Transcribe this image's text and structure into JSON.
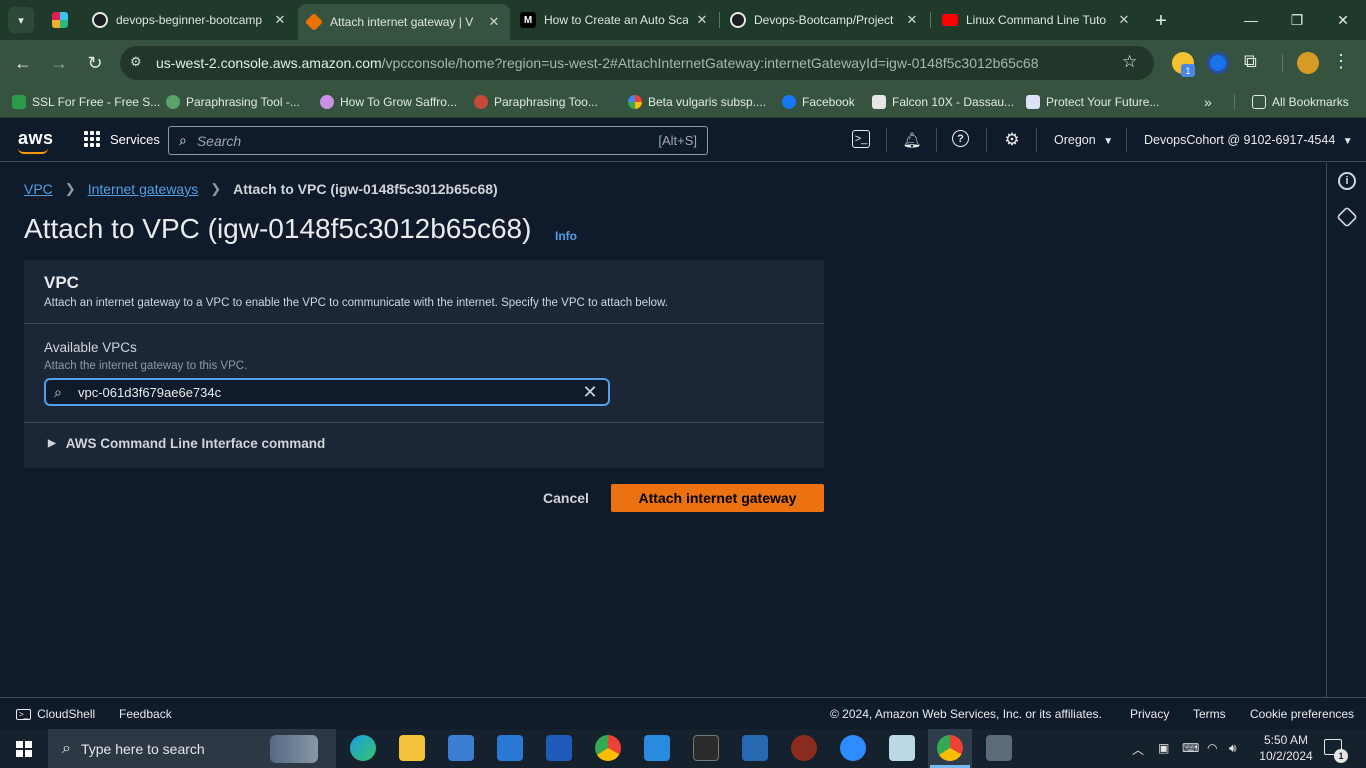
{
  "browser": {
    "tabs": [
      {
        "title": "devops-beginner-bootcamp",
        "active": false
      },
      {
        "title": "Attach internet gateway | V",
        "active": true
      },
      {
        "title": "How to Create an Auto Sca",
        "active": false
      },
      {
        "title": "Devops-Bootcamp/Project",
        "active": false
      },
      {
        "title": "Linux Command Line Tuto",
        "active": false
      }
    ],
    "url_host": "us-west-2.console.aws.amazon.com",
    "url_path": "/vpcconsole/home?region=us-west-2#AttachInternetGateway:internetGatewayId=igw-0148f5c3012b65c68",
    "extension_badge": "1",
    "bookmarks": [
      "SSL For Free - Free S...",
      "Paraphrasing Tool -...",
      "How To Grow Saffro...",
      "Paraphrasing Too...",
      "Beta vulgaris subsp....",
      "Facebook",
      "Falcon 10X - Dassau...",
      "Protect Your Future..."
    ],
    "all_bookmarks": "All Bookmarks"
  },
  "aws_header": {
    "logo": "aws",
    "services": "Services",
    "search_placeholder": "Search",
    "search_shortcut": "[Alt+S]",
    "region": "Oregon",
    "account": "DevopsCohort @ 9102-6917-4544"
  },
  "breadcrumb": {
    "vpc": "VPC",
    "internet_gateways": "Internet gateways",
    "current": "Attach to VPC (igw-0148f5c3012b65c68)"
  },
  "page": {
    "title": "Attach to VPC (igw-0148f5c3012b65c68)",
    "info": "Info"
  },
  "panel": {
    "title": "VPC",
    "description": "Attach an internet gateway to a VPC to enable the VPC to communicate with the internet. Specify the VPC to attach below.",
    "field_label": "Available VPCs",
    "field_help": "Attach the internet gateway to this VPC.",
    "field_value": "vpc-061d3f679ae6e734c",
    "cli_toggle": "AWS Command Line Interface command"
  },
  "actions": {
    "cancel": "Cancel",
    "attach": "Attach internet gateway"
  },
  "footer": {
    "cloudshell": "CloudShell",
    "feedback": "Feedback",
    "copyright": "© 2024, Amazon Web Services, Inc. or its affiliates.",
    "privacy": "Privacy",
    "terms": "Terms",
    "cookie": "Cookie preferences"
  },
  "taskbar": {
    "search_placeholder": "Type here to search",
    "time": "5:50 AM",
    "date": "10/2/2024",
    "notification_count": "1"
  },
  "colors": {
    "aws_bg": "#0f1b2a",
    "link": "#539fe5",
    "primary_button": "#ec7211",
    "chrome_frame": "#35533f"
  }
}
